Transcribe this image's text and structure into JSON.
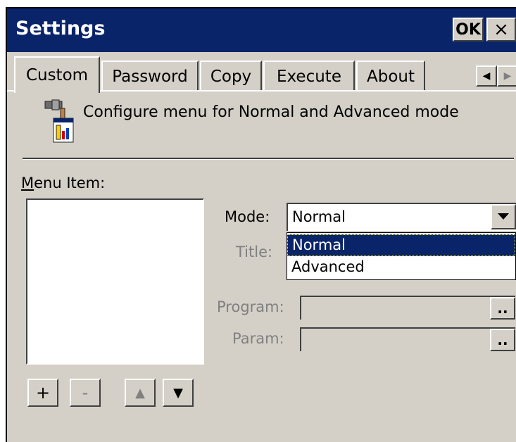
{
  "window": {
    "title": "Settings",
    "ok_label": "OK",
    "close_label": "×"
  },
  "tabs": [
    {
      "label": "Custom",
      "active": true
    },
    {
      "label": "Password"
    },
    {
      "label": "Copy"
    },
    {
      "label": "Execute"
    },
    {
      "label": "About"
    }
  ],
  "tab_scroll": {
    "left": "◀",
    "right": "▶"
  },
  "description": "Configure menu for Normal and Advanced mode",
  "menu_item": {
    "label": "Menu Item:",
    "items": []
  },
  "list_buttons": {
    "add": "+",
    "remove": "-",
    "up": "▲",
    "down": "▼"
  },
  "mode": {
    "label": "Mode:",
    "value": "Normal",
    "options": [
      "Normal",
      "Advanced"
    ],
    "selected": "Normal"
  },
  "title_field": {
    "label": "Title:"
  },
  "program": {
    "label": "Program:",
    "browse": ".."
  },
  "param": {
    "label": "Param:",
    "browse": ".."
  },
  "colors": {
    "titlebar": "#0a246a",
    "face": "#d4d0c8",
    "highlight": "#0a246a"
  }
}
